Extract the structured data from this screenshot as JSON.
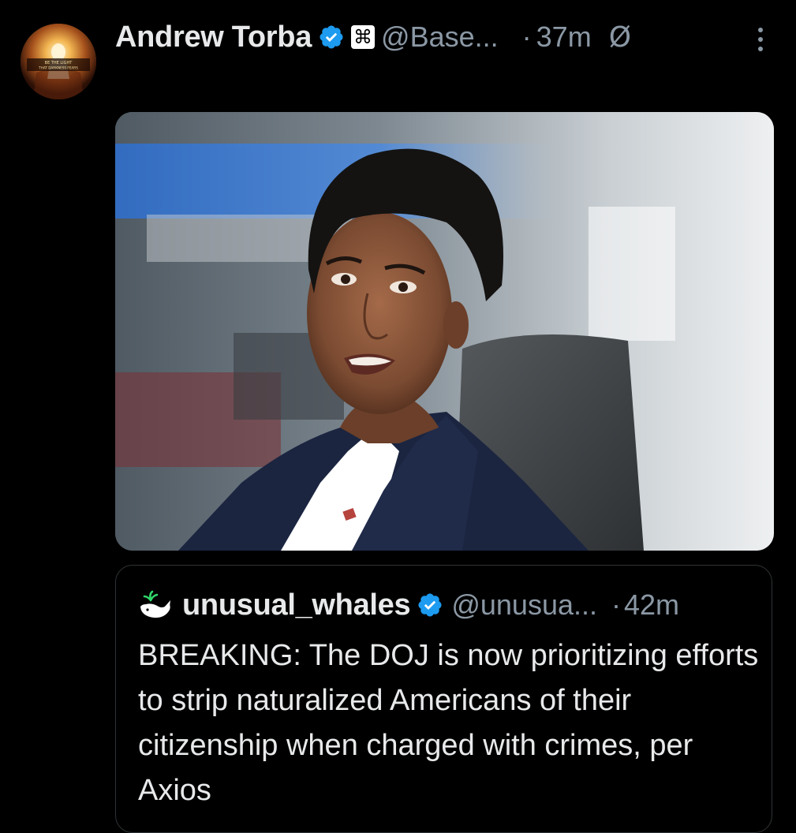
{
  "tweet": {
    "author_name": "Andrew Torba",
    "badge_icon": "command-key-icon",
    "badge_glyph": "⌘",
    "handle": "@Base...",
    "separator": "·",
    "time": "37m",
    "status_glyph": "Ø",
    "avatar_text_line1": "BE THE LIGHT",
    "avatar_text_line2": "THAT DARKNESS FEARS"
  },
  "quote": {
    "name": "unusual_whales",
    "handle": "@unusua...",
    "separator": "·",
    "time": "42m",
    "text": "BREAKING: The DOJ is now prioritizing efforts to strip naturalized Americans of their citizenship when charged with crimes, per Axios"
  },
  "colors": {
    "background": "#000000",
    "text_primary": "#e7e9ea",
    "text_secondary": "#8b98a5",
    "verified_blue": "#1d9bf0",
    "border": "#2f3336"
  }
}
